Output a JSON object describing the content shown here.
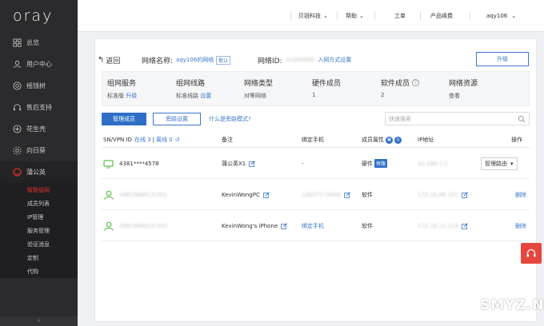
{
  "sidebar": {
    "logo": "oray",
    "items": [
      {
        "label": "总览",
        "icon": "grid-icon"
      },
      {
        "label": "用户中心",
        "icon": "user-icon"
      },
      {
        "label": "摇钱树",
        "icon": "target-icon"
      },
      {
        "label": "售后支持",
        "icon": "headset-icon"
      },
      {
        "label": "花生壳",
        "icon": "peanut-icon"
      },
      {
        "label": "向日葵",
        "icon": "sunflower-icon"
      },
      {
        "label": "蒲公英",
        "icon": "dandelion-icon"
      }
    ],
    "subitems": [
      {
        "label": "智能组网",
        "active": true
      },
      {
        "label": "成员列表",
        "active": false
      },
      {
        "label": "IP管理",
        "active": false
      },
      {
        "label": "服务管理",
        "active": false
      },
      {
        "label": "验证消息",
        "active": false
      },
      {
        "label": "定制",
        "active": false
      },
      {
        "label": "代购",
        "active": false
      }
    ],
    "collapse_glyph": "‹"
  },
  "topbar": {
    "company": "贝锐科技",
    "help": "帮助",
    "ticket": "工单",
    "renew": "产品续费",
    "user": "aqy106"
  },
  "header": {
    "back": "返回",
    "network_name_label": "网络名称:",
    "network_name_value": "aqy106的网络",
    "default_badge": "默认",
    "network_id_label": "网络ID:",
    "network_id_value": "41665666",
    "join_link": "入网方式设置",
    "upgrade": "升级"
  },
  "stats": {
    "service": {
      "label": "组网服务",
      "value": "标准版",
      "link": "升级"
    },
    "line": {
      "label": "组网线路",
      "value": "标准线路",
      "link": "设置"
    },
    "type": {
      "label": "网络类型",
      "value": "对等网络"
    },
    "hardware": {
      "label": "硬件成员",
      "value": "1"
    },
    "software": {
      "label": "软件成员",
      "value": "2",
      "help": "?"
    },
    "resource": {
      "label": "网络资源",
      "link": "查看"
    }
  },
  "toolbar": {
    "manage_members": "管理成员",
    "bypass_settings": "旁路设置",
    "what_is_bypass": "什么是旁路模式?",
    "search_placeholder": "快速搜索"
  },
  "table": {
    "headers": {
      "sn": "SN/VPN ID",
      "online": "在线 3",
      "offline": "离线 0",
      "note": "备注",
      "phone": "绑定手机",
      "attr": "成员属性",
      "ip": "IP地址",
      "op": "操作"
    },
    "rows": [
      {
        "id": "4381****4578",
        "note": "蒲公英X1",
        "phone": "-",
        "attr": "硬件",
        "tag": "旁路",
        "ip": "10.168.1.1",
        "op": "管理路由",
        "device": "router-icon"
      },
      {
        "id": "2881668613:001",
        "note": "KevinWongPC",
        "phone": "13627172648",
        "attr": "软件",
        "tag": "",
        "ip": "172.16.66.187",
        "op": "删除",
        "device": "user-icon"
      },
      {
        "id": "2881668613:002",
        "note": "KevinWong's iPhone",
        "phone": "绑定手机",
        "attr": "软件",
        "tag": "",
        "ip": "172.16.11.218",
        "op": "删除",
        "device": "user-icon"
      }
    ]
  },
  "watermark": "SMYZ.NET",
  "colors": {
    "accent": "#2f6fc6",
    "active_red": "#e0322f",
    "sidebar_bg": "#2b2b2d",
    "support": "#e5473f"
  }
}
